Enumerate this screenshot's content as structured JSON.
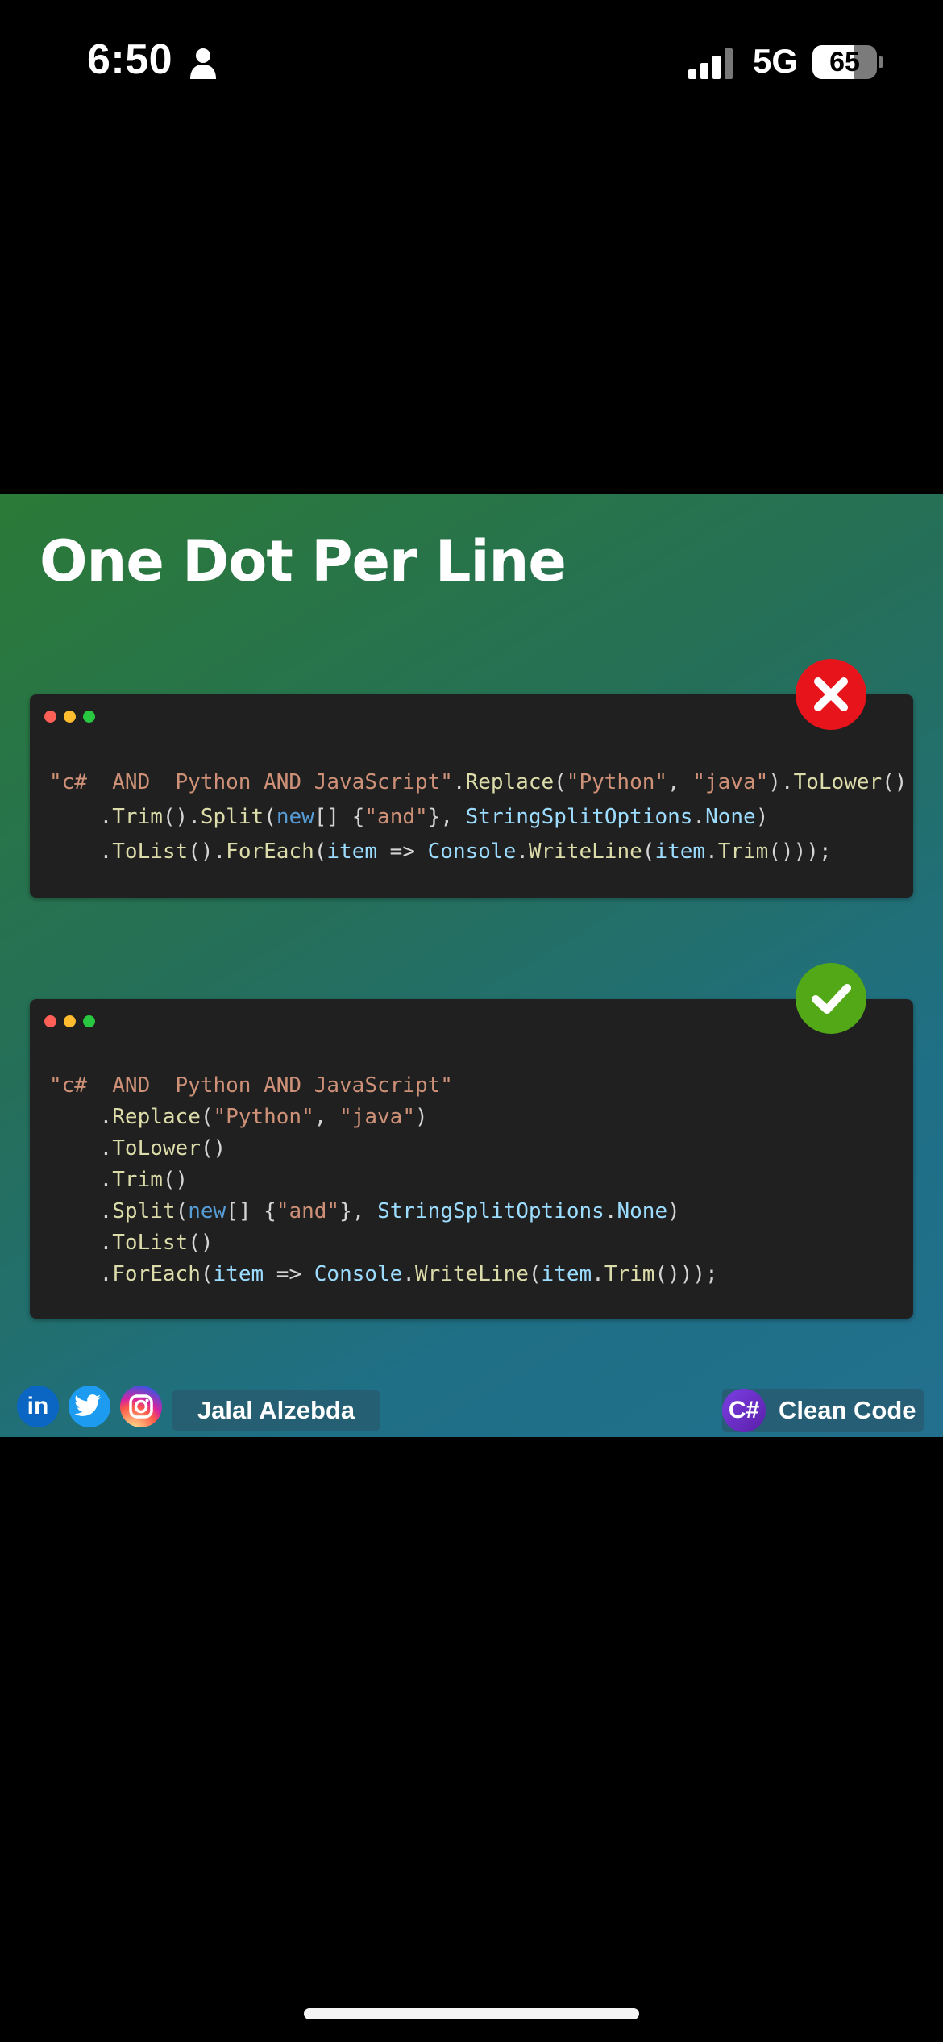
{
  "status_bar": {
    "time": "6:50",
    "network": "5G",
    "battery_percent": "65",
    "battery_level": 0.65,
    "icons": [
      "person-icon",
      "signal-icon",
      "battery-icon"
    ]
  },
  "post": {
    "title": "One Dot Per Line",
    "bad_example": {
      "verdict_icon": "close-icon",
      "verdict_color": "#e8141c",
      "lines": [
        [
          {
            "c": "str",
            "t": "\"c#  AND  Python AND JavaScript\""
          },
          {
            "c": "plain",
            "t": "."
          },
          {
            "c": "method",
            "t": "Replace"
          },
          {
            "c": "plain",
            "t": "("
          },
          {
            "c": "str",
            "t": "\"Python\""
          },
          {
            "c": "plain",
            "t": ", "
          },
          {
            "c": "str",
            "t": "\"java\""
          },
          {
            "c": "plain",
            "t": ")."
          },
          {
            "c": "method",
            "t": "ToLower"
          },
          {
            "c": "plain",
            "t": "()"
          }
        ],
        [
          {
            "c": "plain",
            "t": "    ."
          },
          {
            "c": "method",
            "t": "Trim"
          },
          {
            "c": "plain",
            "t": "()."
          },
          {
            "c": "method",
            "t": "Split"
          },
          {
            "c": "plain",
            "t": "("
          },
          {
            "c": "kw",
            "t": "new"
          },
          {
            "c": "plain",
            "t": "[] {"
          },
          {
            "c": "str",
            "t": "\"and\""
          },
          {
            "c": "plain",
            "t": "}, "
          },
          {
            "c": "type",
            "t": "StringSplitOptions"
          },
          {
            "c": "plain",
            "t": "."
          },
          {
            "c": "type",
            "t": "None"
          },
          {
            "c": "plain",
            "t": ")"
          }
        ],
        [
          {
            "c": "plain",
            "t": "    ."
          },
          {
            "c": "method",
            "t": "ToList"
          },
          {
            "c": "plain",
            "t": "()."
          },
          {
            "c": "method",
            "t": "ForEach"
          },
          {
            "c": "plain",
            "t": "("
          },
          {
            "c": "type",
            "t": "item"
          },
          {
            "c": "plain",
            "t": " => "
          },
          {
            "c": "type",
            "t": "Console"
          },
          {
            "c": "plain",
            "t": "."
          },
          {
            "c": "method",
            "t": "WriteLine"
          },
          {
            "c": "plain",
            "t": "("
          },
          {
            "c": "type",
            "t": "item"
          },
          {
            "c": "plain",
            "t": "."
          },
          {
            "c": "method",
            "t": "Trim"
          },
          {
            "c": "plain",
            "t": "()));"
          }
        ]
      ]
    },
    "good_example": {
      "verdict_icon": "check-icon",
      "verdict_color": "#53a818",
      "lines": [
        [
          {
            "c": "str",
            "t": "\"c#  AND  Python AND JavaScript\""
          }
        ],
        [
          {
            "c": "plain",
            "t": "    ."
          },
          {
            "c": "method",
            "t": "Replace"
          },
          {
            "c": "plain",
            "t": "("
          },
          {
            "c": "str",
            "t": "\"Python\""
          },
          {
            "c": "plain",
            "t": ", "
          },
          {
            "c": "str",
            "t": "\"java\""
          },
          {
            "c": "plain",
            "t": ")"
          }
        ],
        [
          {
            "c": "plain",
            "t": "    ."
          },
          {
            "c": "method",
            "t": "ToLower"
          },
          {
            "c": "plain",
            "t": "()"
          }
        ],
        [
          {
            "c": "plain",
            "t": "    ."
          },
          {
            "c": "method",
            "t": "Trim"
          },
          {
            "c": "plain",
            "t": "()"
          }
        ],
        [
          {
            "c": "plain",
            "t": "    ."
          },
          {
            "c": "method",
            "t": "Split"
          },
          {
            "c": "plain",
            "t": "("
          },
          {
            "c": "kw",
            "t": "new"
          },
          {
            "c": "plain",
            "t": "[] {"
          },
          {
            "c": "str",
            "t": "\"and\""
          },
          {
            "c": "plain",
            "t": "}, "
          },
          {
            "c": "type",
            "t": "StringSplitOptions"
          },
          {
            "c": "plain",
            "t": "."
          },
          {
            "c": "type",
            "t": "None"
          },
          {
            "c": "plain",
            "t": ")"
          }
        ],
        [
          {
            "c": "plain",
            "t": "    ."
          },
          {
            "c": "method",
            "t": "ToList"
          },
          {
            "c": "plain",
            "t": "()"
          }
        ],
        [
          {
            "c": "plain",
            "t": "    ."
          },
          {
            "c": "method",
            "t": "ForEach"
          },
          {
            "c": "plain",
            "t": "("
          },
          {
            "c": "type",
            "t": "item"
          },
          {
            "c": "plain",
            "t": " => "
          },
          {
            "c": "type",
            "t": "Console"
          },
          {
            "c": "plain",
            "t": "."
          },
          {
            "c": "method",
            "t": "WriteLine"
          },
          {
            "c": "plain",
            "t": "("
          },
          {
            "c": "type",
            "t": "item"
          },
          {
            "c": "plain",
            "t": "."
          },
          {
            "c": "method",
            "t": "Trim"
          },
          {
            "c": "plain",
            "t": "()));"
          }
        ]
      ]
    },
    "footer": {
      "social_icons": [
        "linkedin-icon",
        "twitter-icon",
        "instagram-icon"
      ],
      "linkedin_glyph": "in",
      "author": "Jalal Alzebda",
      "brand_badge": "C#",
      "brand_label": "Clean Code"
    }
  },
  "colors": {
    "window_bg": "#202020",
    "string": "#ce9178",
    "method": "#dcdcaa",
    "keyword": "#569cd6",
    "identifier": "#9cdcfe",
    "plain": "#d4d4d4"
  }
}
